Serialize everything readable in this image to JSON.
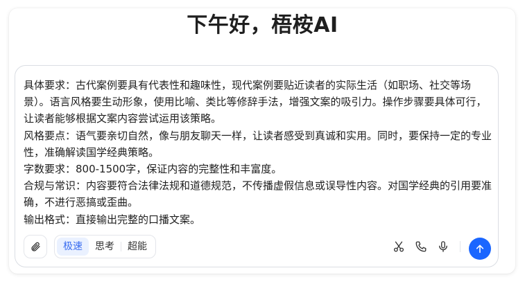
{
  "header": {
    "greeting": "下午好，梧桉AI"
  },
  "composer": {
    "prompt_text": "具体要求：古代案例要具有代表性和趣味性，现代案例要贴近读者的实际生活（如职场、社交等场景）。语言风格要生动形象，使用比喻、类比等修辞手法，增强文案的吸引力。操作步骤要具体可行，让读者能够根据文案内容尝试运用该策略。\n风格要点：语气要亲切自然，像与朋友聊天一样，让读者感受到真诚和实用。同时，要保持一定的专业性，准确解读国学经典策略。\n字数要求：800-1500字，保证内容的完整性和丰富度。\n合规与常识：内容要符合法律法规和道德规范，不传播虚假信息或误导性内容。对国学经典的引用要准确，不进行恶搞或歪曲。\n输出格式：直接输出完整的口播文案。",
    "modes": [
      {
        "label": "极速",
        "active": true
      },
      {
        "label": "思考",
        "active": false
      },
      {
        "label": "超能",
        "active": false
      }
    ],
    "icons": {
      "attach": "paperclip-icon",
      "cut": "scissors-icon",
      "call": "phone-icon",
      "voice": "microphone-icon",
      "send": "arrow-up-icon"
    }
  },
  "colors": {
    "accent": "#1a66ff",
    "active_mode_bg": "#eaf1ff",
    "active_mode_text": "#3a6df0"
  }
}
